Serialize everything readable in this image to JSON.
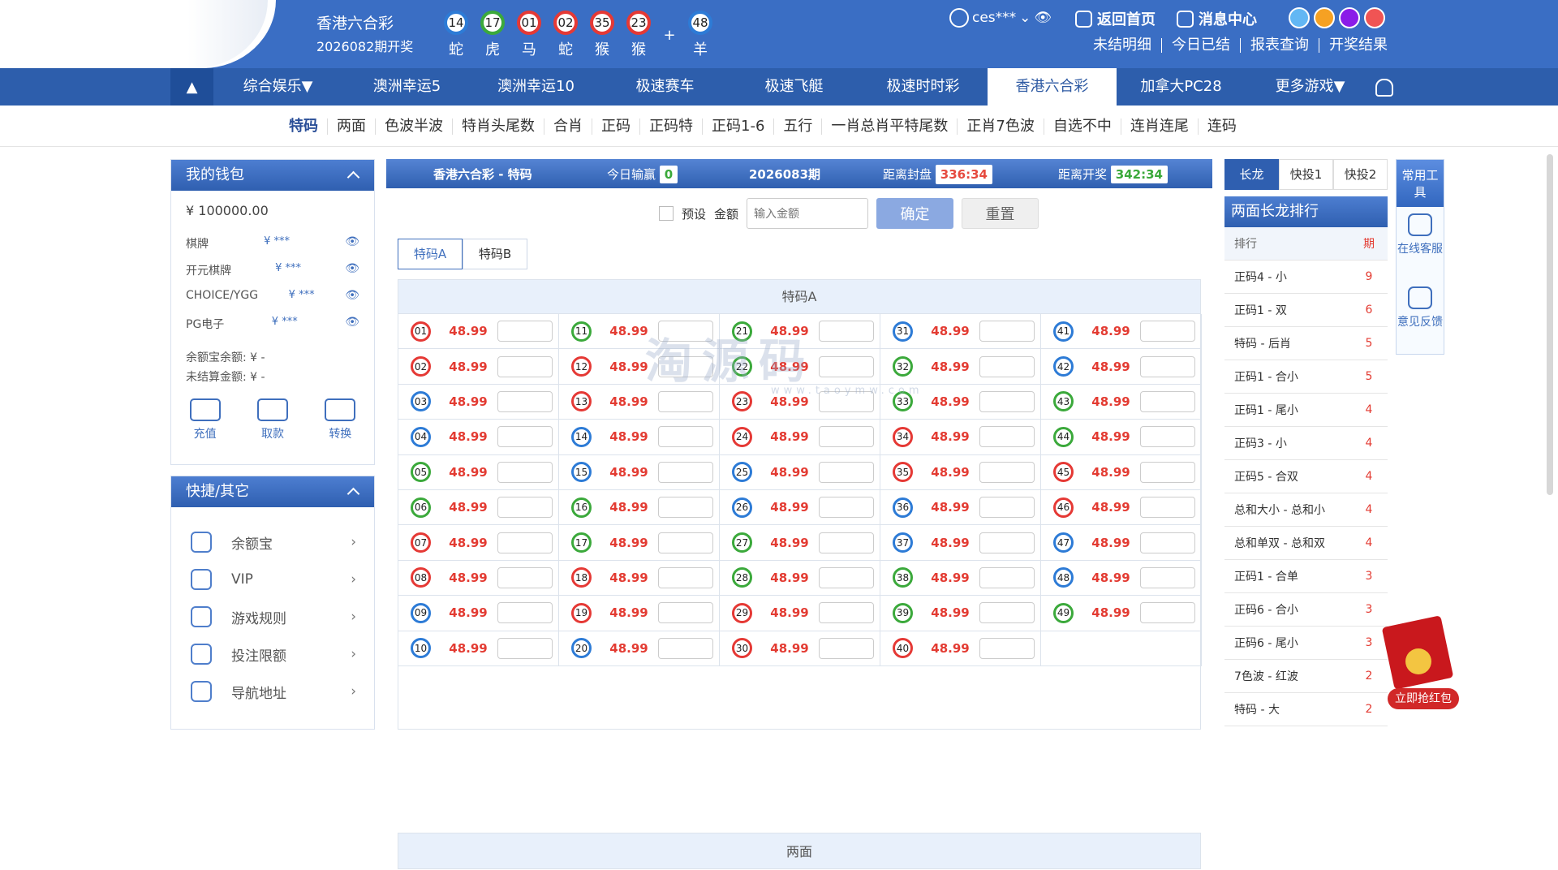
{
  "header": {
    "lottery_name": "香港六合彩",
    "period": "2026082期开奖",
    "balls": [
      {
        "num": "14",
        "zodiac": "蛇",
        "color": "blue"
      },
      {
        "num": "17",
        "zodiac": "虎",
        "color": "green"
      },
      {
        "num": "01",
        "zodiac": "马",
        "color": "red"
      },
      {
        "num": "02",
        "zodiac": "蛇",
        "color": "red"
      },
      {
        "num": "35",
        "zodiac": "猴",
        "color": "red"
      },
      {
        "num": "23",
        "zodiac": "猴",
        "color": "red"
      }
    ],
    "plus": "+",
    "special": {
      "num": "48",
      "zodiac": "羊",
      "color": "blue"
    },
    "user": "ces***",
    "links": [
      "返回首页",
      "消息中心"
    ],
    "sub_links": [
      "未结明细",
      "今日已结",
      "报表查询",
      "开奖结果"
    ],
    "theme_colors": [
      "#62b7f4",
      "#f6a123",
      "#8a1ce8",
      "#f05454"
    ]
  },
  "nav": {
    "up": "▲",
    "items": [
      "综合娱乐▼",
      "澳洲幸运5",
      "澳洲幸运10",
      "极速赛车",
      "极速飞艇",
      "极速时时彩",
      "香港六合彩",
      "加拿大PC28",
      "更多游戏▼"
    ]
  },
  "subnav": [
    "特码",
    "两面",
    "色波半波",
    "特肖头尾数",
    "合肖",
    "正码",
    "正码特",
    "正码1-6",
    "五行",
    "一肖总肖平特尾数",
    "正肖7色波",
    "自选不中",
    "连肖连尾",
    "连码"
  ],
  "wallet": {
    "title": "我的钱包",
    "balance": "¥ 100000.00",
    "rows": [
      {
        "name": "棋牌",
        "value": "¥ ***"
      },
      {
        "name": "开元棋牌",
        "value": "¥ ***"
      },
      {
        "name": "CHOICE/YGG",
        "value": "¥ ***"
      },
      {
        "name": "PG电子",
        "value": "¥ ***"
      }
    ],
    "lines": [
      {
        "name": "余额宝余额:",
        "value": "¥ -"
      },
      {
        "name": "未结算金额:",
        "value": "¥ -"
      }
    ],
    "actions": [
      "充值",
      "取款",
      "转换"
    ]
  },
  "quick": {
    "title": "快捷/其它",
    "items": [
      "余额宝",
      "VIP",
      "游戏规则",
      "投注限额",
      "导航地址"
    ]
  },
  "main": {
    "title": "香港六合彩 - 特码",
    "today_label": "今日输赢",
    "today_value": "0",
    "issue": "2026083期",
    "close_label": "距离封盘",
    "close_time": "336:34",
    "open_label": "距离开奖",
    "open_time": "342:34",
    "preset": "预设",
    "amount_label": "金额",
    "amount_placeholder": "输入金额",
    "confirm": "确定",
    "reset": "重置",
    "tabs": [
      "特码A",
      "特码B"
    ],
    "table_title": "特码A",
    "odd": "48.99",
    "section2": "两面"
  },
  "numbers": [
    {
      "n": "01",
      "c": "red"
    },
    {
      "n": "11",
      "c": "green"
    },
    {
      "n": "21",
      "c": "green"
    },
    {
      "n": "31",
      "c": "blue"
    },
    {
      "n": "41",
      "c": "blue"
    },
    {
      "n": "02",
      "c": "red"
    },
    {
      "n": "12",
      "c": "red"
    },
    {
      "n": "22",
      "c": "green"
    },
    {
      "n": "32",
      "c": "green"
    },
    {
      "n": "42",
      "c": "blue"
    },
    {
      "n": "03",
      "c": "blue"
    },
    {
      "n": "13",
      "c": "red"
    },
    {
      "n": "23",
      "c": "red"
    },
    {
      "n": "33",
      "c": "green"
    },
    {
      "n": "43",
      "c": "green"
    },
    {
      "n": "04",
      "c": "blue"
    },
    {
      "n": "14",
      "c": "blue"
    },
    {
      "n": "24",
      "c": "red"
    },
    {
      "n": "34",
      "c": "red"
    },
    {
      "n": "44",
      "c": "green"
    },
    {
      "n": "05",
      "c": "green"
    },
    {
      "n": "15",
      "c": "blue"
    },
    {
      "n": "25",
      "c": "blue"
    },
    {
      "n": "35",
      "c": "red"
    },
    {
      "n": "45",
      "c": "red"
    },
    {
      "n": "06",
      "c": "green"
    },
    {
      "n": "16",
      "c": "green"
    },
    {
      "n": "26",
      "c": "blue"
    },
    {
      "n": "36",
      "c": "blue"
    },
    {
      "n": "46",
      "c": "red"
    },
    {
      "n": "07",
      "c": "red"
    },
    {
      "n": "17",
      "c": "green"
    },
    {
      "n": "27",
      "c": "green"
    },
    {
      "n": "37",
      "c": "blue"
    },
    {
      "n": "47",
      "c": "blue"
    },
    {
      "n": "08",
      "c": "red"
    },
    {
      "n": "18",
      "c": "red"
    },
    {
      "n": "28",
      "c": "green"
    },
    {
      "n": "38",
      "c": "green"
    },
    {
      "n": "48",
      "c": "blue"
    },
    {
      "n": "09",
      "c": "blue"
    },
    {
      "n": "19",
      "c": "red"
    },
    {
      "n": "29",
      "c": "red"
    },
    {
      "n": "39",
      "c": "green"
    },
    {
      "n": "49",
      "c": "green"
    },
    {
      "n": "10",
      "c": "blue"
    },
    {
      "n": "20",
      "c": "blue"
    },
    {
      "n": "30",
      "c": "red"
    },
    {
      "n": "40",
      "c": "red"
    }
  ],
  "right": {
    "tabs": [
      "长龙",
      "快投1",
      "快投2"
    ],
    "title": "两面长龙排行",
    "head": [
      "排行",
      "期"
    ],
    "rows": [
      {
        "name": "正码4 - 小",
        "val": "9"
      },
      {
        "name": "正码1 - 双",
        "val": "6"
      },
      {
        "name": "特码 - 后肖",
        "val": "5"
      },
      {
        "name": "正码1 - 合小",
        "val": "5"
      },
      {
        "name": "正码1 - 尾小",
        "val": "4"
      },
      {
        "name": "正码3 - 小",
        "val": "4"
      },
      {
        "name": "正码5 - 合双",
        "val": "4"
      },
      {
        "name": "总和大小 - 总和小",
        "val": "4"
      },
      {
        "name": "总和单双 - 总和双",
        "val": "4"
      },
      {
        "name": "正码1 - 合单",
        "val": "3"
      },
      {
        "name": "正码6 - 合小",
        "val": "3"
      },
      {
        "name": "正码6 - 尾小",
        "val": "3"
      },
      {
        "name": "7色波 - 红波",
        "val": "2"
      },
      {
        "name": "特码 - 大",
        "val": "2"
      }
    ]
  },
  "tools": {
    "title": "常用工具",
    "items": [
      "在线客服",
      "意见反馈"
    ]
  },
  "redpack": "立即抢红包",
  "watermark": {
    "main": "淘源码",
    "sub": "www.taoymw.com"
  }
}
